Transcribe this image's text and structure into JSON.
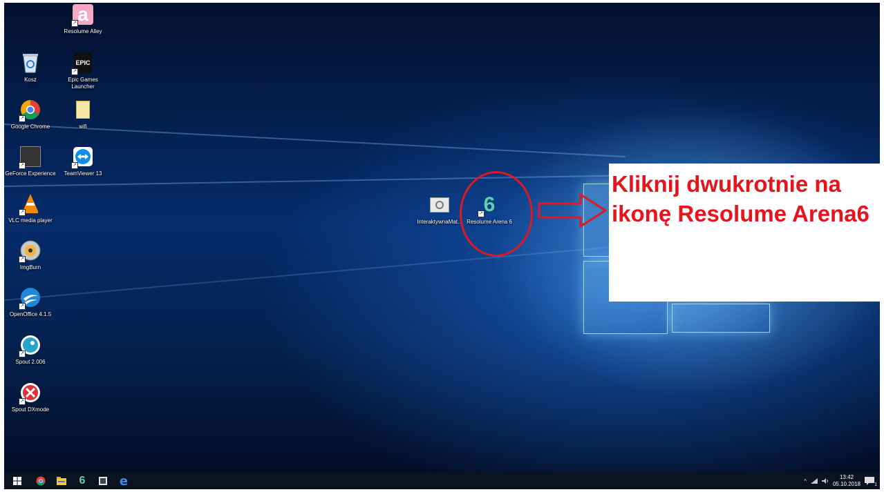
{
  "desktop": {
    "icons": [
      {
        "label": "Resolume Alley",
        "icon": "resolume-alley-icon"
      },
      {
        "label": "Kosz",
        "icon": "recycle-bin-icon"
      },
      {
        "label": "Epic Games Launcher",
        "icon": "epic-games-icon",
        "glyph": "EPIC"
      },
      {
        "label": "Google Chrome",
        "icon": "chrome-icon"
      },
      {
        "label": "wifi",
        "icon": "folder-icon"
      },
      {
        "label": "GeForce Experience",
        "icon": "geforce-icon"
      },
      {
        "label": "TeamViewer 13",
        "icon": "teamviewer-icon"
      },
      {
        "label": "VLC media player",
        "icon": "vlc-icon"
      },
      {
        "label": "ImgBurn",
        "icon": "imgburn-icon"
      },
      {
        "label": "OpenOffice 4.1.5",
        "icon": "openoffice-icon"
      },
      {
        "label": "Spout 2.006",
        "icon": "spout-icon"
      },
      {
        "label": "Spout DXmode",
        "icon": "spout-dxmode-icon"
      },
      {
        "label": "InteraktywnaMat...",
        "icon": "interaktywna-mata-icon"
      },
      {
        "label": "Resolume Arena 6",
        "icon": "resolume-arena-icon",
        "glyph": "6"
      }
    ]
  },
  "callout": {
    "text": "Kliknij dwukrotnie na ikonę Resolume Arena6"
  },
  "taskbar": {
    "items": [
      "start-icon",
      "chrome-icon",
      "file-explorer-icon",
      "resolume-arena-icon",
      "app-icon",
      "edge-icon"
    ],
    "tray": {
      "chevron": "^",
      "clock_time": "13:42",
      "clock_date": "05.10.2018",
      "notification_count": "1"
    }
  },
  "colors": {
    "callout_text": "#e8141b",
    "highlight": "#e01820",
    "taskbar": "#0b1220"
  }
}
